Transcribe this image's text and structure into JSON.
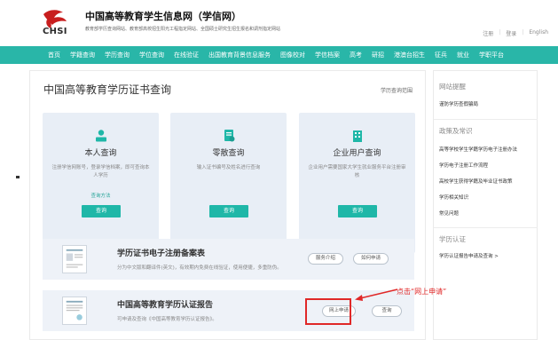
{
  "header": {
    "logo_text": "CHSI",
    "site_title": "中国高等教育学生信息网（学信网）",
    "site_subtitle": "教育部学历查询网站、教育部高校招生阳光工程指定网站、全国硕士研究生招生报名和调剂指定网站",
    "top_links": [
      "注册",
      "登录",
      "English"
    ]
  },
  "nav": {
    "items": [
      "首页",
      "学籍查询",
      "学历查询",
      "学位查询",
      "在线验证",
      "出国教育背景信息服务",
      "图像校对",
      "学信档案",
      "高考",
      "研招",
      "港澳台招生",
      "征兵",
      "就业",
      "学职平台"
    ]
  },
  "main": {
    "title": "中国高等教育学历证书查询",
    "range_link": "学历查询范围",
    "cards": [
      {
        "title": "本人查询",
        "desc": "注册学信网账号，登录学信档案，即可查询本人学历",
        "link": "查询方法",
        "button": "查询",
        "icon": "person-icon"
      },
      {
        "title": "零散查询",
        "desc": "输入证书编号及姓名进行查询",
        "link": "",
        "button": "查询",
        "icon": "document-icon"
      },
      {
        "title": "企业用户查询",
        "desc": "企业用户需要国家大学生就业服务平台注册审核",
        "link": "",
        "button": "查询",
        "icon": "building-icon"
      }
    ],
    "services": [
      {
        "title": "学历证书电子注册备案表",
        "desc": "分为中文版和翻译件(英文)，有效期内免费在线验证，使用便捷，多重防伪。",
        "buttons": [
          "服务介绍",
          "如何申请"
        ]
      },
      {
        "title": "中国高等教育学历认证报告",
        "desc": "可申请及查询《中国高等教育学历认证报告》。",
        "buttons": [
          "网上申请",
          "查询"
        ]
      }
    ]
  },
  "sidebar": {
    "sections": [
      {
        "heading": "网站提醒",
        "items": [
          "谨防学历查假骗局"
        ]
      },
      {
        "heading": "政策及常识",
        "items": [
          "高等学校学生学籍学历电子注册办法",
          "学历电子注册工作流程",
          "高校学生获得学籍及毕业证书政策",
          "学历相关知识",
          "常见问题"
        ]
      },
      {
        "heading": "学历认证",
        "items": [
          "学历认证报告申请及查询 >"
        ]
      }
    ]
  },
  "annotation": {
    "text": "点击“网上申请”",
    "color": "#e02828"
  },
  "colors": {
    "nav": "#29b6a8",
    "button": "#1fb7a8",
    "card": "#e8eef6",
    "highlight": "#e02828"
  }
}
